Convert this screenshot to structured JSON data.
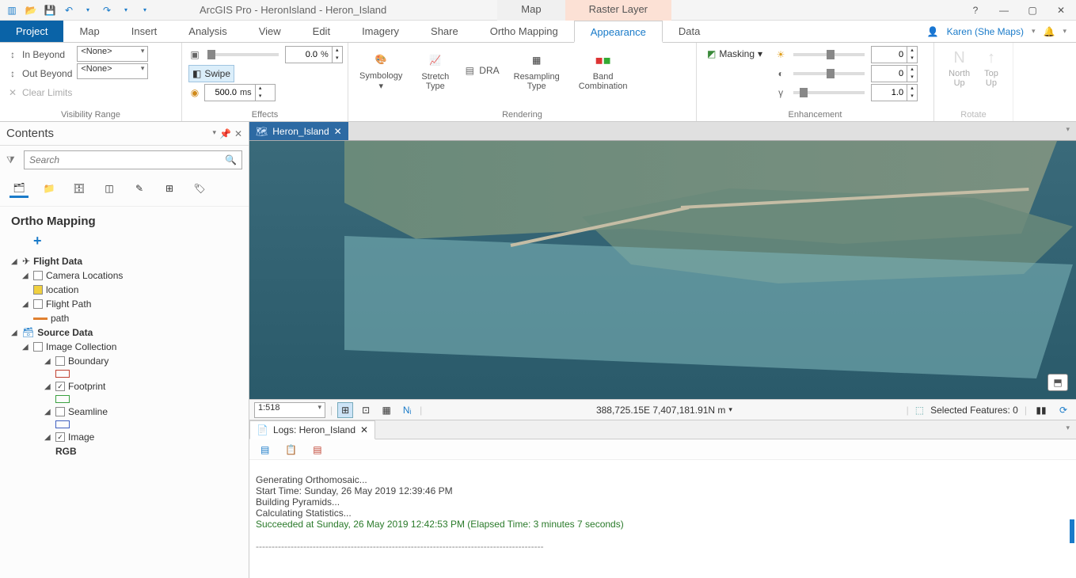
{
  "title": "ArcGIS Pro - HeronIsland - Heron_Island",
  "context_tabs": {
    "map": "Map",
    "raster": "Raster Layer"
  },
  "user": "Karen (She Maps)",
  "menu": {
    "project": "Project",
    "map": "Map",
    "insert": "Insert",
    "analysis": "Analysis",
    "view": "View",
    "edit": "Edit",
    "imagery": "Imagery",
    "share": "Share",
    "ortho": "Ortho Mapping",
    "appearance": "Appearance",
    "data": "Data"
  },
  "ribbon": {
    "visibility": {
      "label": "Visibility Range",
      "in_beyond": "In Beyond",
      "out_beyond": "Out Beyond",
      "clear": "Clear Limits",
      "none": "<None>"
    },
    "effects": {
      "label": "Effects",
      "transparency_val": "0.0",
      "transparency_unit": "%",
      "swipe": "Swipe",
      "flicker_val": "500.0",
      "flicker_unit": "ms"
    },
    "rendering": {
      "label": "Rendering",
      "symbology": "Symbology",
      "stretch": "Stretch\nType",
      "dra": "DRA",
      "resampling": "Resampling\nType",
      "band": "Band\nCombination"
    },
    "enhancement": {
      "label": "Enhancement",
      "masking": "Masking",
      "brightness": "0",
      "contrast": "0",
      "gamma": "1.0"
    },
    "rotate": {
      "label": "Rotate",
      "north": "North\nUp",
      "top": "Top\nUp"
    }
  },
  "contents": {
    "title": "Contents",
    "search_placeholder": "Search",
    "heading": "Ortho Mapping",
    "flight_data": "Flight Data",
    "camera_locations": "Camera Locations",
    "location": "location",
    "flight_path": "Flight Path",
    "path": "path",
    "source_data": "Source Data",
    "image_collection": "Image Collection",
    "boundary": "Boundary",
    "footprint": "Footprint",
    "seamline": "Seamline",
    "image": "Image",
    "rgb": "RGB"
  },
  "map_tab": "Heron_Island",
  "map_status": {
    "scale": "1:518",
    "coords": "388,725.15E 7,407,181.91N m",
    "selected": "Selected Features: 0"
  },
  "log": {
    "tab": "Logs: Heron_Island",
    "l1": "Generating Orthomosaic...",
    "l2": "Start Time: Sunday, 26 May 2019 12:39:46 PM",
    "l3": "Building Pyramids...",
    "l4": "Calculating Statistics...",
    "l5": "Succeeded at Sunday, 26 May 2019 12:42:53 PM (Elapsed Time: 3 minutes 7 seconds)",
    "l6": "-------------------------------------------------------------------------------------------"
  }
}
